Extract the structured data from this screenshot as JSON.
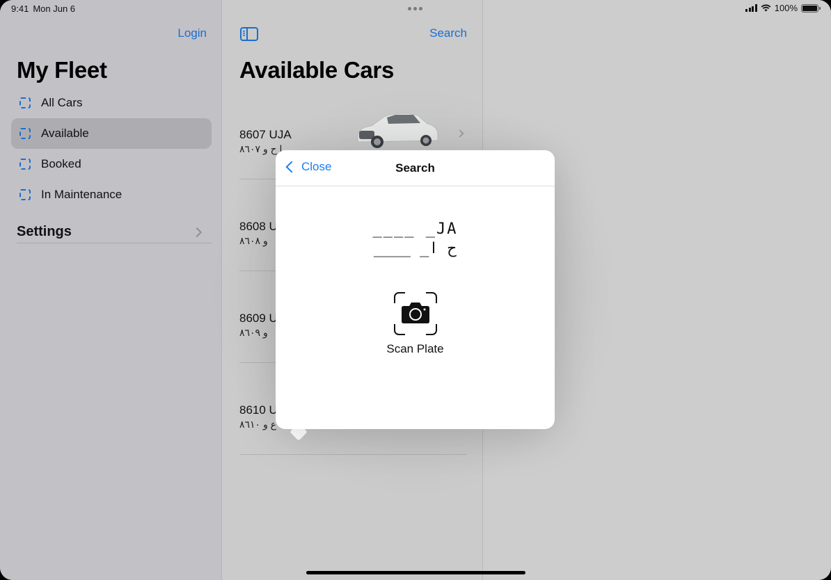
{
  "status_bar": {
    "time": "9:41",
    "date": "Mon Jun 6",
    "battery_percent": "100%",
    "icons": [
      "cellular-signal-icon",
      "wifi-icon",
      "battery-icon"
    ]
  },
  "sidebar": {
    "login_label": "Login",
    "title": "My Fleet",
    "items": [
      {
        "label": "All Cars",
        "icon": "dashed-square-icon",
        "selected": false
      },
      {
        "label": "Available",
        "icon": "dashed-square-icon",
        "selected": true
      },
      {
        "label": "Booked",
        "icon": "dashed-square-icon",
        "selected": false
      },
      {
        "label": "In Maintenance",
        "icon": "dashed-square-icon",
        "selected": false
      }
    ],
    "settings_label": "Settings"
  },
  "content": {
    "title": "Available Cars",
    "search_label": "Search",
    "cars": [
      {
        "plate_en": "8607 UJA",
        "plate_ar": "ا ح و ٨٦٠٧"
      },
      {
        "plate_en": "8608 U",
        "plate_ar": "و ٨٦٠٨"
      },
      {
        "plate_en": "8609 U",
        "plate_ar": "و ٨٦٠٩"
      },
      {
        "plate_en": "8610 U",
        "plate_ar": "ع و ٨٦١٠"
      }
    ]
  },
  "popover": {
    "close_label": "Close",
    "title": "Search",
    "mask_latin": "____ _JA",
    "mask_arabic": "____ _ح ا",
    "scan_label": "Scan Plate"
  },
  "colors": {
    "accent": "#1a6ecf",
    "popover_accent": "#1a7ef0"
  }
}
